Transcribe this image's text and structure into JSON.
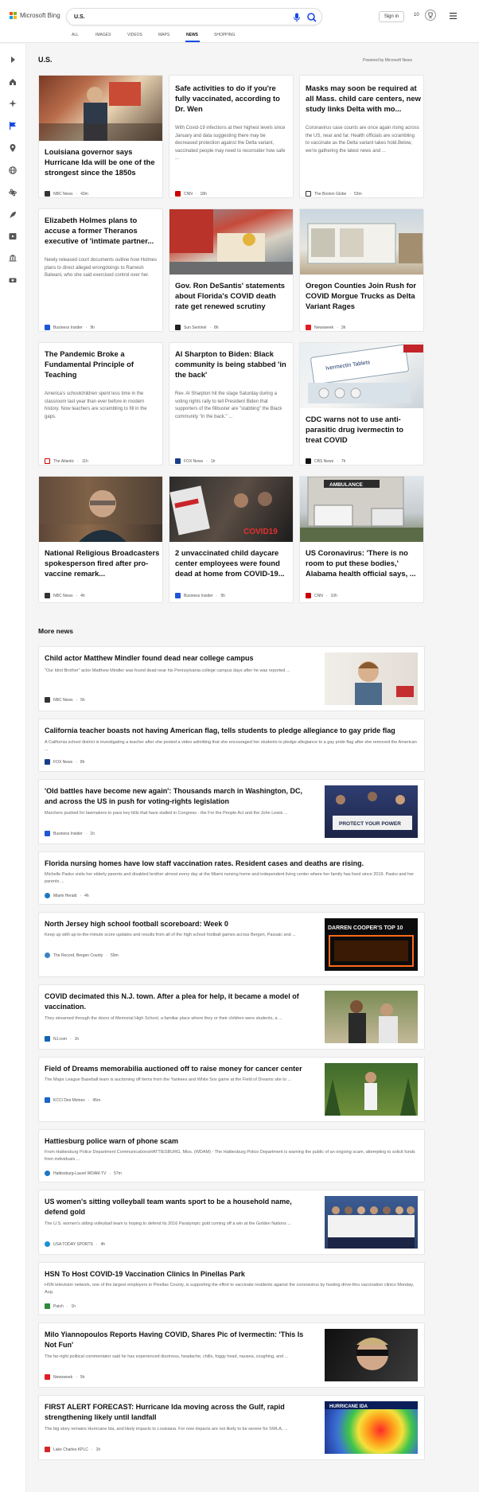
{
  "header": {
    "logo_text": "Microsoft Bing",
    "search_value": "U.S.",
    "signin_label": "Sign in",
    "rewards_points": "10",
    "tabs": [
      "ALL",
      "IMAGES",
      "VIDEOS",
      "MAPS",
      "NEWS",
      "SHOPPING"
    ],
    "active_tab": "NEWS",
    "accent_color": "#174ae4"
  },
  "rail": {
    "icons": [
      "collapse-arrow-icon",
      "home-icon",
      "discover-icon",
      "flag-icon",
      "location-pin-icon",
      "globe-icon",
      "science-icon",
      "rocket-icon",
      "entertainment-icon",
      "building-icon",
      "money-icon"
    ]
  },
  "main": {
    "title": "U.S.",
    "powered_by": "Powered by Microsoft News",
    "cards": [
      {
        "title": "Louisiana governor says Hurricane Ida will be one of the strongest since the 1850s",
        "snippet": "",
        "source": "NBC News",
        "time": "43m",
        "has_image": true
      },
      {
        "title": "Safe activities to do if you're fully vaccinated, according to Dr. Wen",
        "snippet": "With Covid-19 infections at their highest levels since January and data suggesting there may be decreased protection against the Delta variant, vaccinated people may need to reconsider how safe ...",
        "source": "CNN",
        "time": "18h",
        "has_image": false
      },
      {
        "title": "Masks may soon be required at all Mass. child care centers, new study links Delta with mo...",
        "snippet": "Coronavirus case counts are once again rising across the US, near and far. Health officials are scrambling to vaccinate as the Delta variant takes hold.Below, we're gathering the latest news and ...",
        "source": "The Boston Globe",
        "time": "53m",
        "has_image": false
      },
      {
        "title": "Elizabeth Holmes plans to accuse a former Theranos executive of 'intimate partner...",
        "snippet": "Newly released court documents outline how Holmes plans to direct alleged wrongdoings to Ramesh Balwani, who she said exercised control over her.",
        "source": "Business Insider",
        "time": "9h",
        "has_image": false
      },
      {
        "title": "Gov. Ron DeSantis' statements about Florida's COVID death rate get renewed scrutiny",
        "snippet": "",
        "source": "Sun Sentinel",
        "time": "8h",
        "has_image": true
      },
      {
        "title": "Oregon Counties Join Rush for COVID Morgue Trucks as Delta Variant Rages",
        "snippet": "",
        "source": "Newsweek",
        "time": "3h",
        "has_image": true
      },
      {
        "title": "The Pandemic Broke a Fundamental Principle of Teaching",
        "snippet": "America's schoolchildren spent less time in the classroom last year than ever before in modern history. Now teachers are scrambling to fill in the gaps.",
        "source": "The Atlantic",
        "time": "11h",
        "has_image": false
      },
      {
        "title": "Al Sharpton to Biden: Black community is being stabbed 'in the back'",
        "snippet": "Rev. Al Sharpton hit the stage Saturday during a voting rights rally to tell President Biden that supporters of the filibuster are \"stabbing\" the Black community \"in the back.\" ...",
        "source": "FOX News",
        "time": "1h",
        "has_image": false
      },
      {
        "title": "CDC warns not to use anti-parasitic drug ivermectin to treat COVID",
        "snippet": "",
        "source": "CBS News",
        "time": "7h",
        "has_image": true,
        "img_text": "Ivermectin Tablets"
      },
      {
        "title": "National Religious Broadcasters spokesperson fired after pro-vaccine remark...",
        "snippet": "",
        "source": "NBC News",
        "time": "4h",
        "has_image": true
      },
      {
        "title": "2 unvaccinated child daycare center employees were found dead at home from COVID-19...",
        "snippet": "",
        "source": "Business Insider",
        "time": "9h",
        "has_image": true,
        "img_text": "COVID19"
      },
      {
        "title": "US Coronavirus: 'There is no room to put these bodies,' Alabama health official says, ...",
        "snippet": "",
        "source": "CNN",
        "time": "10h",
        "has_image": true,
        "img_text": "AMBULANCE"
      }
    ]
  },
  "more_news": {
    "title": "More news",
    "items": [
      {
        "title": "Child actor Matthew Mindler found dead near college campus",
        "snippet": "\"Our Idiot Brother\" actor Matthew Mindler was found dead near his Pennsylvania college campus days after he was reported ...",
        "source": "NBC News",
        "time": "5h",
        "has_image": true
      },
      {
        "title": "California teacher boasts not having American flag, tells students to pledge allegiance to gay pride flag",
        "snippet": "A California school district is investigating a teacher after she posted a video admitting that she encouraged her students to pledge allegiance to a gay pride flag after she removed the American ...",
        "source": "FOX News",
        "time": "8h",
        "has_image": false
      },
      {
        "title": "'Old battles have become new again': Thousands march in Washington, DC, and across the US in push for voting-rights legislation",
        "snippet": "Marchers pushed for lawmakers to pass key bills that have stalled in Congress - the For the People Act and the John Lewis ...",
        "source": "Business Insider",
        "time": "1h",
        "has_image": true,
        "img_text": "PROTECT YOUR POWER"
      },
      {
        "title": "Florida nursing homes have low staff vaccination rates. Resident cases and deaths are rising.",
        "snippet": "Michelle Pasko visits her elderly parents and disabled brother almost every day at the Miami nursing home and independent living center where her family has lived since 2019. Pasko and her parents ...",
        "source": "Miami Herald",
        "time": "4h",
        "has_image": false
      },
      {
        "title": "North Jersey high school football scoreboard: Week 0",
        "snippet": "Keep up with up-to-the-minute score updates and results from all of the high school football games across Bergen, Passaic and ...",
        "source": "The Record, Bergen County",
        "time": "59m",
        "has_image": true,
        "img_text": "DARREN COOPER'S TOP 10"
      },
      {
        "title": "COVID decimated this N.J. town. After a plea for help, it became a model of vaccination.",
        "snippet": "They streamed through the doors of Memorial High School, a familiar place where they or their children were students, a ...",
        "source": "NJ.com",
        "time": "1h",
        "has_image": true
      },
      {
        "title": "Field of Dreams memorabilia auctioned off to raise money for cancer center",
        "snippet": "The Major League Baseball team is auctioning off items from the Yankees and White Sox game at the Field of Dreams site to ...",
        "source": "KCCI Des Moines",
        "time": "45m",
        "has_image": true
      },
      {
        "title": "Hattiesburg police warn of phone scam",
        "snippet": "From Hattiesburg Police Department CommunicationsHATTIESBURG, Miss. (WDAM) - The Hattiesburg Police Department is warning the public of an ongoing scam, attempting to solicit funds from individuals ...",
        "source": "Hattiesburg-Laurel WDAM-TV",
        "time": "57m",
        "has_image": false
      },
      {
        "title": "US women's sitting volleyball team wants sport to be a household name, defend gold",
        "snippet": "The U.S. women's sitting volleyball team is hoping to defend its 2016 Paralympic gold coming off a win at the Golden Nations ...",
        "source": "USA TODAY SPORTS",
        "time": "4h",
        "has_image": true
      },
      {
        "title": "HSN To Host COVID-19 Vaccination Clinics In Pinellas Park",
        "snippet": "HSN television network, one of the largest employers in Pinellas County, is supporting the effort to vaccinate residents against the coronavirus by hosting drive-thru vaccination clinics Monday, Aug.",
        "source": "Patch",
        "time": "1h",
        "has_image": false
      },
      {
        "title": "Milo Yiannopoulos Reports Having COVID, Shares Pic of Ivermectin: 'This Is Not Fun'",
        "snippet": "The far-right political commentator said he has experienced dizziness, headache, chills, foggy head, nausea, coughing, and ...",
        "source": "Newsweek",
        "time": "5h",
        "has_image": true
      },
      {
        "title": "FIRST ALERT FORECAST: Hurricane Ida moving across the Gulf, rapid strengthening likely until landfall",
        "snippet": "The big story remains Hurricane Ida, and likely impacts to Louisiana. For now impacts are not likely to be severe for SWLA, ...",
        "source": "Lake Charles KPLC",
        "time": "1h",
        "has_image": true,
        "img_text": "HURRICANE IDA"
      }
    ]
  }
}
